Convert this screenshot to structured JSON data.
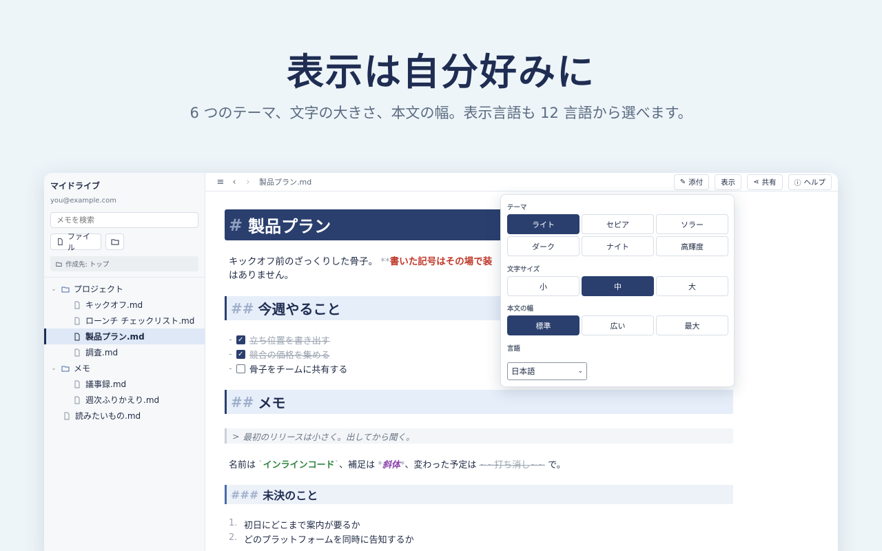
{
  "hero": {
    "title": "表示は自分好みに",
    "subtitle": "6 つのテーマ、文字の大きさ、本文の幅。表示言語も 12 言語から選べます。"
  },
  "sidebar": {
    "title": "マイドライブ",
    "email": "you@example.com",
    "search_placeholder": "メモを検索",
    "file_button": "ファイル",
    "destination": "作成先: トップ",
    "tree": [
      {
        "label": "プロジェクト",
        "type": "folder"
      },
      {
        "label": "キックオフ.md",
        "type": "file"
      },
      {
        "label": "ローンチ チェックリスト.md",
        "type": "file"
      },
      {
        "label": "製品プラン.md",
        "type": "file",
        "active": true
      },
      {
        "label": "調査.md",
        "type": "file"
      },
      {
        "label": "メモ",
        "type": "folder"
      },
      {
        "label": "議事録.md",
        "type": "file"
      },
      {
        "label": "週次ふりかえり.md",
        "type": "file"
      },
      {
        "label": "読みたいもの.md",
        "type": "file"
      }
    ]
  },
  "topbar": {
    "breadcrumb": "製品プラン.md",
    "attach": "添付",
    "view": "表示",
    "share": "共有",
    "help": "ヘルプ"
  },
  "doc": {
    "h1_mark": "#",
    "h1": "製品プラン",
    "para_text": "キックオフ前のざっくりした骨子。",
    "para_marker": "**",
    "para_red": "書いた記号はその場で装",
    "para_cont": "はありません。",
    "h2a_mark": "##",
    "h2a": "今週やること",
    "tasks": [
      {
        "dash": "-",
        "text": "立ち位置を書き出す",
        "done": true
      },
      {
        "dash": "-",
        "text": "競合の価格を集める",
        "done": true
      },
      {
        "dash": "-",
        "text": "骨子をチームに共有する",
        "done": false
      }
    ],
    "h2b_mark": "##",
    "h2b": "メモ",
    "quote_mark": ">",
    "quote": "最初のリリースは小さく。出してから聞く。",
    "inline": {
      "p1": "名前は",
      "bt": "`",
      "code": "インラインコード",
      "p2": "、補足は",
      "star": "*",
      "em": "斜体",
      "p3": "、変わった予定は",
      "strike": "~~打ち消し~~",
      "p4": "で。"
    },
    "h3_mark": "###",
    "h3": "未決のこと",
    "ordered": [
      {
        "num": "1.",
        "text": "初日にどこまで案内が要るか"
      },
      {
        "num": "2.",
        "text": "どのプラットフォームを同時に告知するか"
      }
    ]
  },
  "popover": {
    "theme_label": "テーマ",
    "themes": [
      "ライト",
      "セピア",
      "ソラー",
      "ダーク",
      "ナイト",
      "高輝度"
    ],
    "theme_selected": "ライト",
    "size_label": "文字サイズ",
    "sizes": [
      "小",
      "中",
      "大"
    ],
    "size_selected": "中",
    "width_label": "本文の幅",
    "widths": [
      "標準",
      "広い",
      "最大"
    ],
    "width_selected": "標準",
    "lang_label": "言語",
    "lang_value": "日本語"
  },
  "colors": {
    "accent": "#2a3f6e",
    "background": "#eef5f9",
    "red_text": "#c0392b",
    "code_green": "#2e8540",
    "emphasis_purple": "#8e44ad"
  }
}
